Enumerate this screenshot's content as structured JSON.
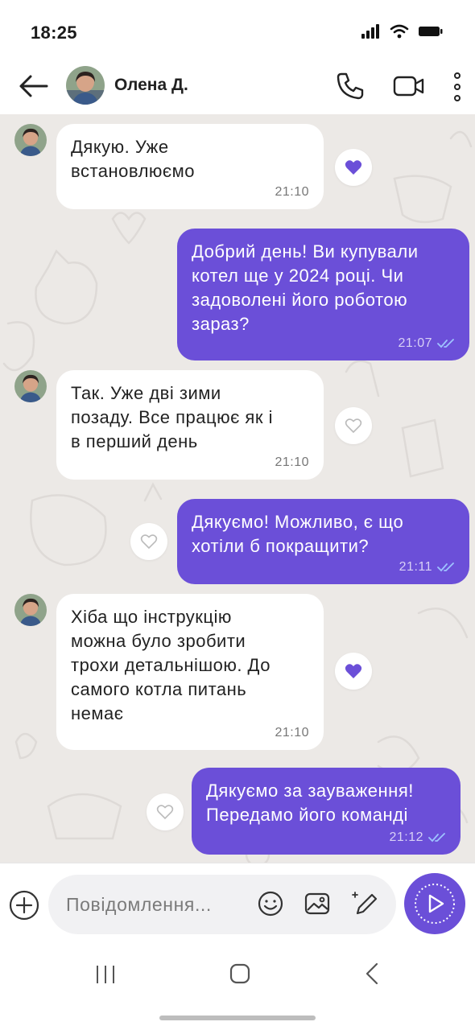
{
  "status_bar": {
    "time": "18:25",
    "icons": [
      "signal-icon",
      "wifi-icon",
      "battery-icon"
    ]
  },
  "header": {
    "contact_name": "Олена Д.",
    "icons": [
      "back-arrow-icon",
      "phone-icon",
      "video-camera-icon",
      "more-vertical-icon"
    ]
  },
  "colors": {
    "accent": "#6b4fd8",
    "chat_background": "#ece9e6",
    "incoming_bubble": "#ffffff"
  },
  "messages": [
    {
      "direction": "in",
      "lines": [
        "Дякую. Уже",
        "встановлюємо"
      ],
      "time": "21:10",
      "reaction": "heart-filled"
    },
    {
      "direction": "out",
      "lines": [
        "Добрий день! Ви купували",
        "котел ще у 2024 році. Чи",
        "задоволені його роботою",
        "зараз?"
      ],
      "time": "21:07",
      "status": "read"
    },
    {
      "direction": "in",
      "lines": [
        "Так. Уже дві зими",
        "позаду. Все працює як і",
        "в перший день"
      ],
      "time": "21:10",
      "reaction": "heart-outline"
    },
    {
      "direction": "out",
      "lines": [
        "Дякуємо! Можливо, є що",
        "хотіли б покращити?"
      ],
      "time": "21:11",
      "status": "read",
      "reaction": "heart-outline"
    },
    {
      "direction": "in",
      "lines": [
        "Хіба що інструкцію",
        "можна було зробити",
        "трохи детальнішою. До",
        "самого котла питань",
        "немає"
      ],
      "time": "21:10",
      "reaction": "heart-filled"
    },
    {
      "direction": "out",
      "lines": [
        "Дякуємо за зауваження!",
        "Передамо його команді"
      ],
      "time": "21:12",
      "status": "read",
      "reaction": "heart-outline"
    }
  ],
  "input_bar": {
    "placeholder": "Повідомлення...",
    "icons": [
      "plus-icon",
      "emoji-icon",
      "gallery-icon",
      "draw-icon",
      "send-icon"
    ]
  },
  "nav_bar": {
    "icons": [
      "recent-apps-icon",
      "home-icon",
      "back-icon"
    ]
  }
}
